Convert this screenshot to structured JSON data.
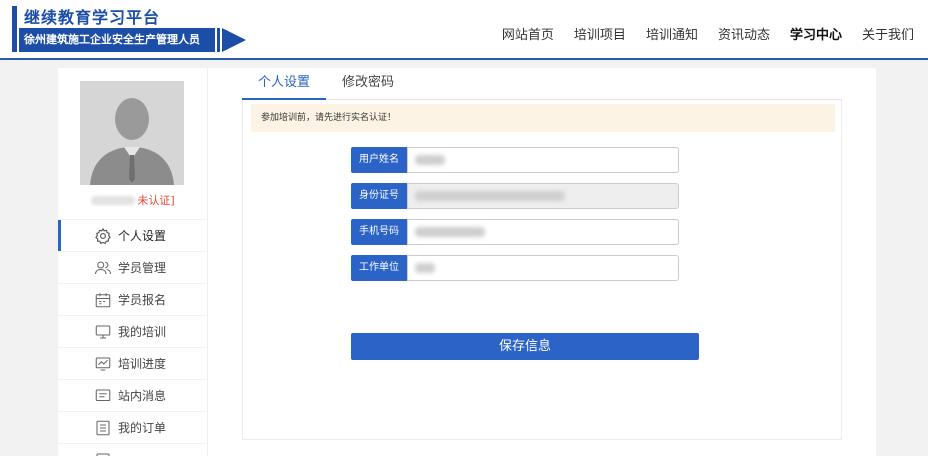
{
  "header": {
    "site_title": "继续教育学习平台",
    "subtitle": "徐州建筑施工企业安全生产管理人员",
    "nav": [
      {
        "label": "网站首页",
        "active": false
      },
      {
        "label": "培训项目",
        "active": false
      },
      {
        "label": "培训通知",
        "active": false
      },
      {
        "label": "资讯动态",
        "active": false
      },
      {
        "label": "学习中心",
        "active": true
      },
      {
        "label": "关于我们",
        "active": false
      }
    ]
  },
  "sidebar": {
    "verify_link": "未认证]",
    "menu": [
      {
        "label": "个人设置",
        "icon": "gear-icon",
        "active": true
      },
      {
        "label": "学员管理",
        "icon": "users-icon",
        "active": false
      },
      {
        "label": "学员报名",
        "icon": "calendar-icon",
        "active": false
      },
      {
        "label": "我的培训",
        "icon": "monitor-icon",
        "active": false
      },
      {
        "label": "培训进度",
        "icon": "chart-icon",
        "active": false
      },
      {
        "label": "站内消息",
        "icon": "message-icon",
        "active": false
      },
      {
        "label": "我的订单",
        "icon": "list-icon",
        "active": false
      }
    ]
  },
  "content": {
    "tabs": [
      {
        "label": "个人设置",
        "active": true
      },
      {
        "label": "修改密码",
        "active": false
      }
    ],
    "notice": "参加培训前，请先进行实名认证！",
    "form": {
      "name_label": "用户姓名",
      "id_label": "身份证号",
      "phone_label": "手机号码",
      "company_label": "工作单位"
    },
    "save_label": "保存信息"
  },
  "colors": {
    "brand": "#1c4ea8",
    "accent": "#2b63c6",
    "notice_bg": "#fdf3e4",
    "warning": "#e43333"
  }
}
